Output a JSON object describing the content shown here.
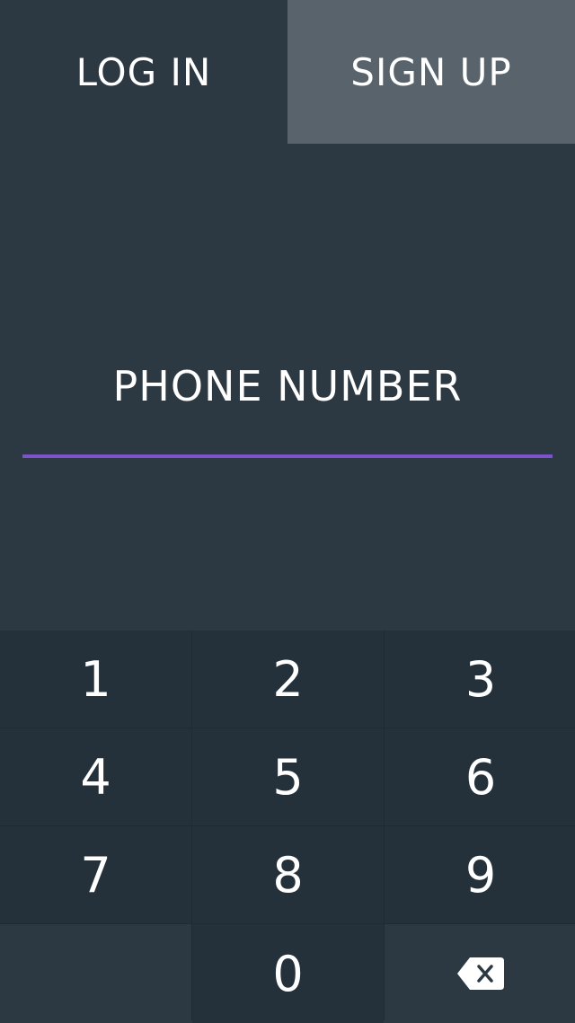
{
  "tabs": {
    "login_label": "LOG IN",
    "signup_label": "SIGN UP"
  },
  "phone": {
    "label": "PHONE NUMBER",
    "value": "",
    "underline_color": "#7b55c7"
  },
  "keypad": {
    "keys": [
      "1",
      "2",
      "3",
      "4",
      "5",
      "6",
      "7",
      "8",
      "9",
      "",
      "0",
      "backspace"
    ],
    "backspace_icon": "backspace-icon"
  },
  "colors": {
    "background": "#2d3942",
    "signup_tab": "#58636b",
    "key_background": "#25313a",
    "accent": "#7b55c7"
  }
}
